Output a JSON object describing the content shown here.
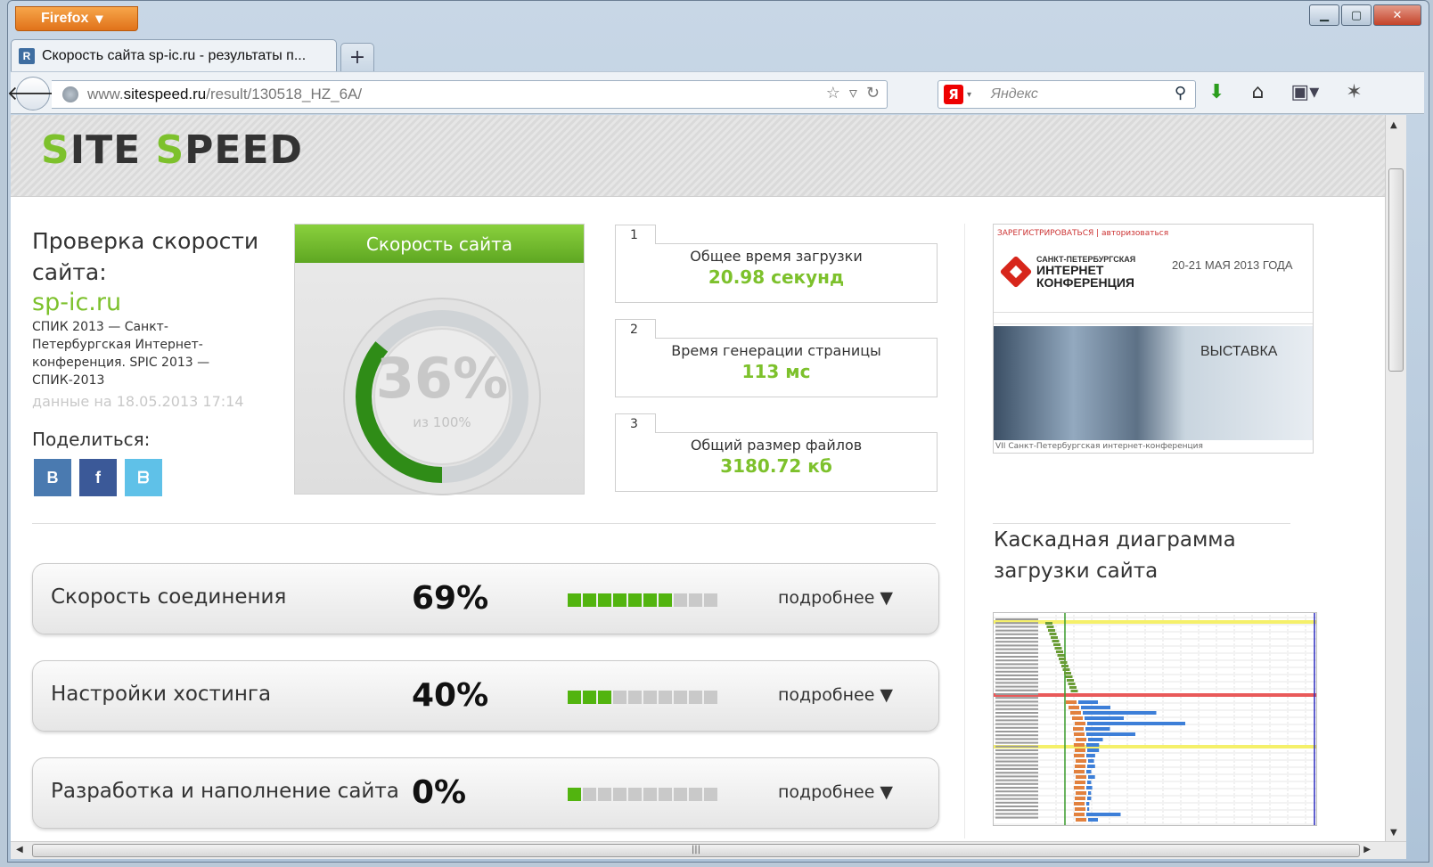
{
  "browser": {
    "app_button": "Firefox",
    "tab_title": "Скорость сайта sp-ic.ru - результаты п...",
    "url_domain": "www.",
    "url_bold": "sitespeed.ru",
    "url_path": "/result/130518_HZ_6A/",
    "search_placeholder": "Яндекс",
    "search_engine_icon": "Я",
    "new_tab_label": "+"
  },
  "header": {
    "logo_s1": "S",
    "logo_rest1": "ITE ",
    "logo_s2": "S",
    "logo_rest2": "PEED"
  },
  "summary": {
    "title": "Проверка скорости сайта:",
    "domain": "sp-ic.ru",
    "description": "СПИК 2013 — Санкт-Петербургская Интернет-конференция. SPIC 2013 — СПИК-2013",
    "date": "данные на 18.05.2013 17:14",
    "share_label": "Поделиться:",
    "share_buttons": [
      {
        "label": "В",
        "color": "#4a7ab0"
      },
      {
        "label": "f",
        "color": "#3b5998"
      },
      {
        "label": "ᗷ",
        "color": "#5fc1e8"
      }
    ]
  },
  "speed": {
    "title": "Скорость сайта",
    "percent": "36%",
    "percent_value": 0.36,
    "sub": "из 100%"
  },
  "metrics": [
    {
      "num": "1",
      "label": "Общее время загрузки",
      "value": "20.98 секунд"
    },
    {
      "num": "2",
      "label": "Время генерации страницы",
      "value": "113 мс"
    },
    {
      "num": "3",
      "label": "Общий размер файлов",
      "value": "3180.72 кб"
    }
  ],
  "categories": [
    {
      "name": "Скорость соединения",
      "percent": "69%",
      "filled": 7,
      "total": 10,
      "more": "подробнее ▼"
    },
    {
      "name": "Настройки хостинга",
      "percent": "40%",
      "filled": 3,
      "total": 10,
      "more": "подробнее ▼"
    },
    {
      "name": "Разработка и наполнение сайта",
      "percent": "0%",
      "filled": 1,
      "total": 10,
      "more": "подробнее ▼"
    }
  ],
  "banner": {
    "top_text": "ЗАРЕГИСТРИРОВАТЬСЯ | авторизоваться",
    "line1": "САНКТ-ПЕТЕРБУРГСКАЯ",
    "line2": "ИНТЕРНЕТ",
    "line3": "КОНФЕРЕНЦИЯ",
    "dates": "20-21 МАЯ 2013 ГОДА",
    "photo_caption": "ВЫСТАВКА",
    "bottom": "VII Санкт-Петербургская интернет-конференция"
  },
  "cascade": {
    "title": "Каскадная диаграмма загрузки сайта"
  },
  "colors": {
    "accent_green": "#7dc12c",
    "bar_green": "#52b40f",
    "highlight_yellow": "#f5f06a",
    "highlight_red": "#e95a5a",
    "bar_blue": "#3d7fd8",
    "bar_orange": "#e2813e"
  }
}
